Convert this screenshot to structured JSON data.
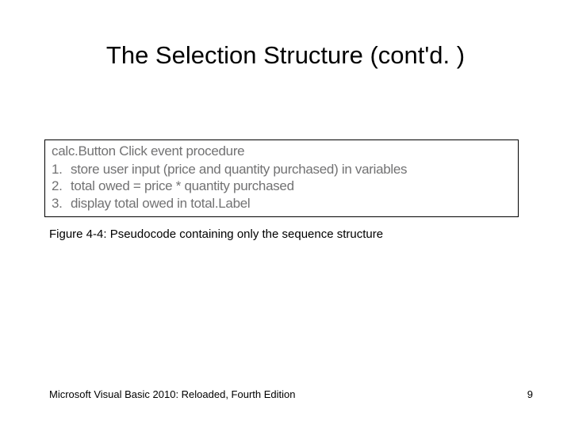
{
  "title": "The Selection Structure (cont'd. )",
  "pseudocode": {
    "procedure_title": "calc.Button Click event procedure",
    "steps": [
      {
        "n": "1.",
        "text": "store user input (price and quantity purchased) in variables"
      },
      {
        "n": "2.",
        "text": "total owed = price * quantity purchased"
      },
      {
        "n": "3.",
        "text": "display total owed in total.Label"
      }
    ]
  },
  "caption": "Figure 4-4: Pseudocode containing only the sequence structure",
  "footer": {
    "left": "Microsoft Visual Basic 2010: Reloaded, Fourth Edition",
    "page": "9"
  }
}
